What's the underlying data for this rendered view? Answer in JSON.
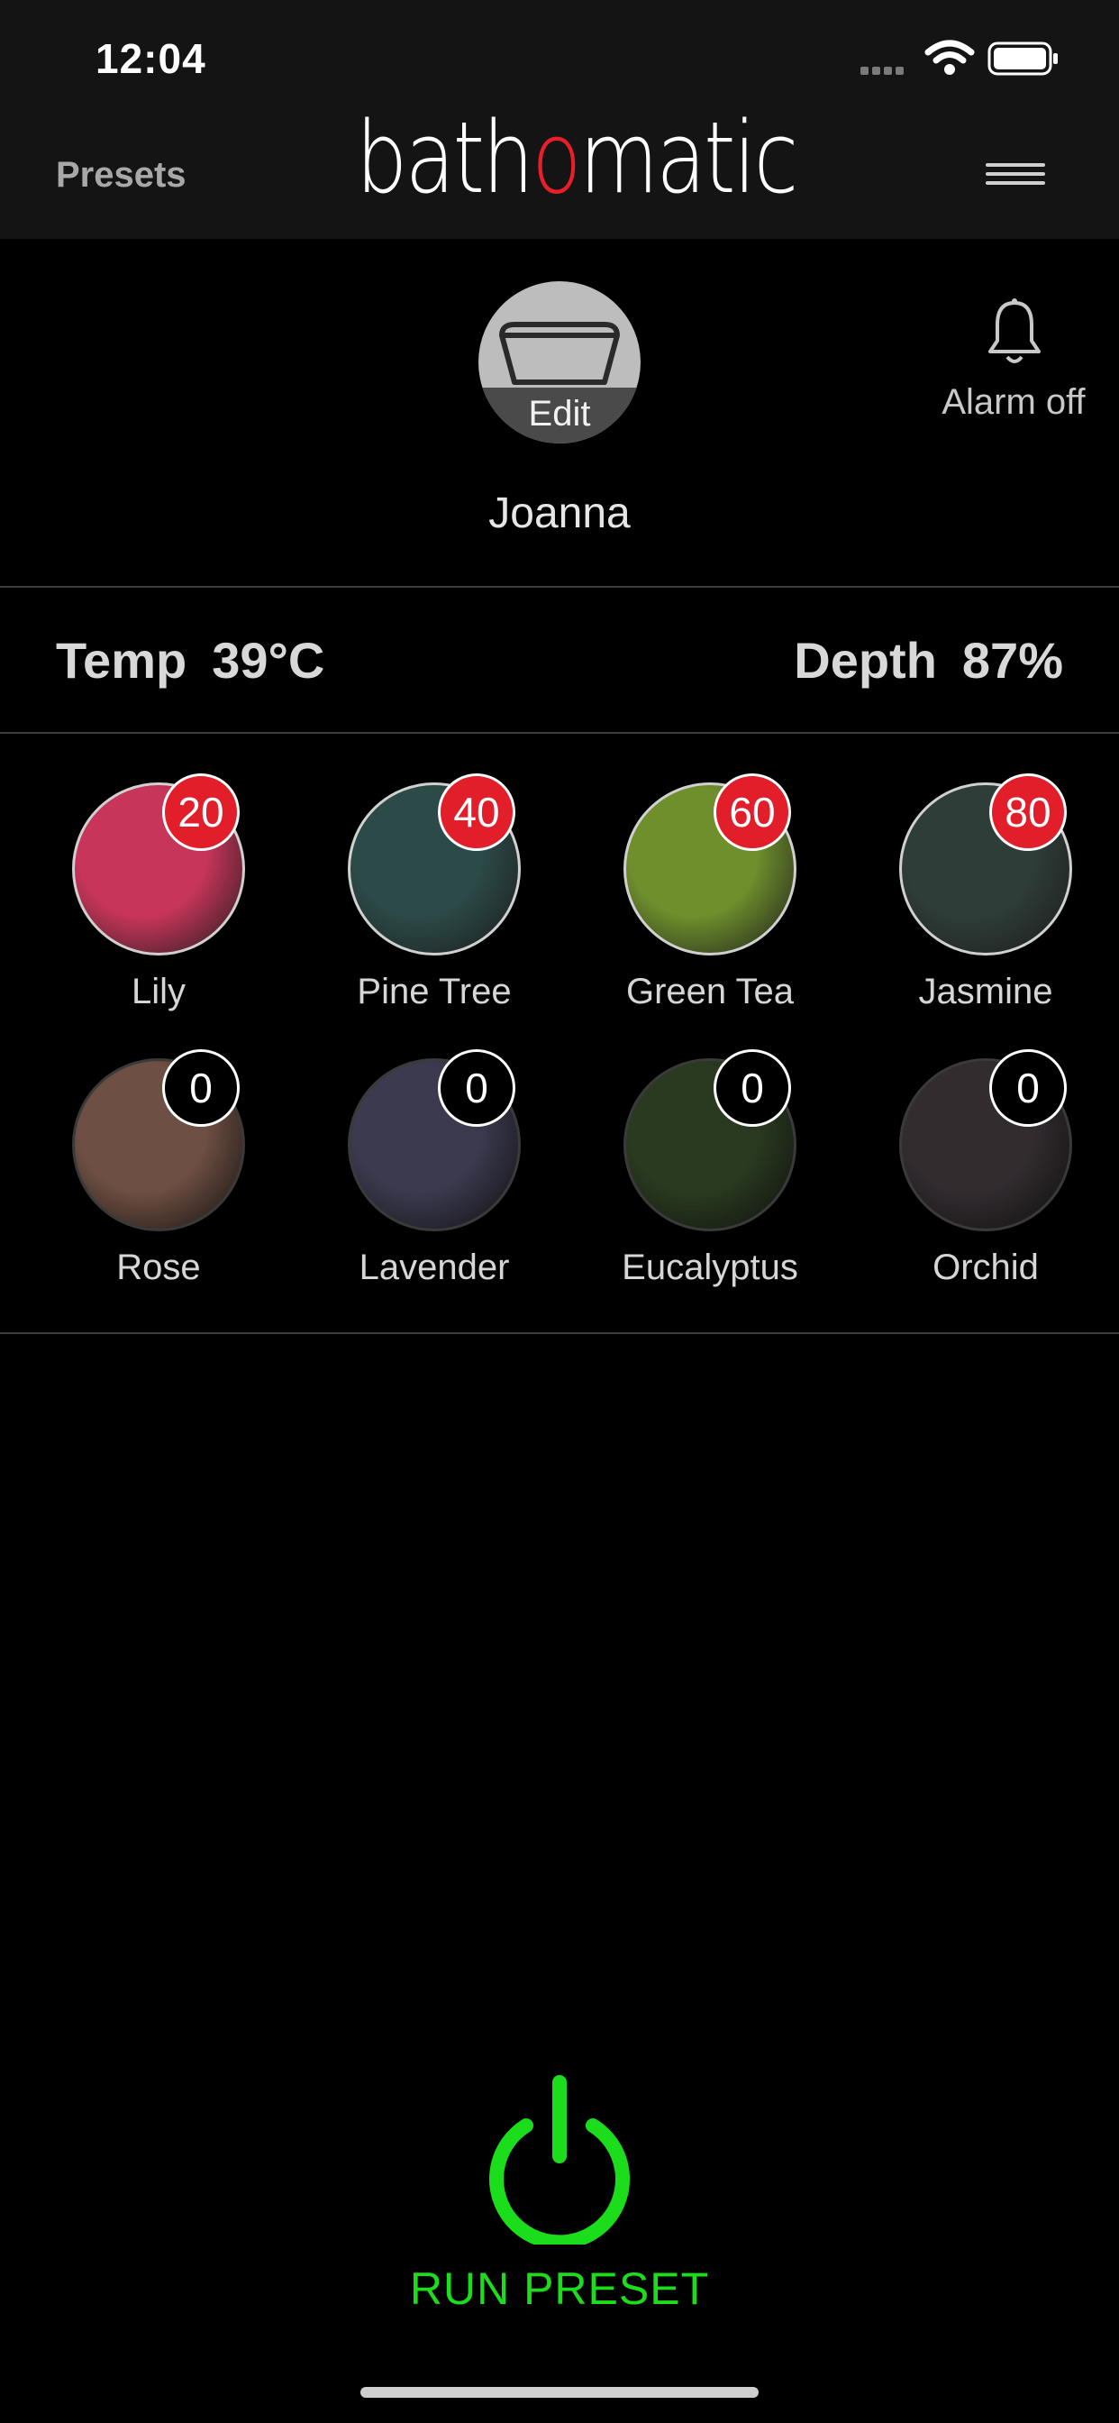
{
  "status_bar": {
    "time": "12:04",
    "icons": [
      "cellular-signal-icon",
      "wifi-icon",
      "battery-icon"
    ]
  },
  "header": {
    "presets_label": "Presets",
    "logo_text": {
      "before": "bath",
      "accent": "o",
      "after": "matic"
    },
    "menu_icon": "hamburger-menu-icon"
  },
  "profile": {
    "avatar_icon": "bathtub-icon",
    "edit_label": "Edit",
    "name": "Joanna",
    "alarm_label": "Alarm off",
    "alarm_icon": "bell-icon"
  },
  "settings": {
    "temp_label": "Temp",
    "temp_value": "39°C",
    "depth_label": "Depth",
    "depth_value": "87%"
  },
  "scents": [
    {
      "name": "Lily",
      "value": "20",
      "active": true,
      "color": "#c8355a"
    },
    {
      "name": "Pine Tree",
      "value": "40",
      "active": true,
      "color": "#2c4a48"
    },
    {
      "name": "Green Tea",
      "value": "60",
      "active": true,
      "color": "#6f8f2c"
    },
    {
      "name": "Jasmine",
      "value": "80",
      "active": true,
      "color": "#2f3d38"
    },
    {
      "name": "Rose",
      "value": "0",
      "active": false,
      "color": "#c9907a"
    },
    {
      "name": "Lavender",
      "value": "0",
      "active": false,
      "color": "#6d6a8f"
    },
    {
      "name": "Eucalyptus",
      "value": "0",
      "active": false,
      "color": "#4d6b3c"
    },
    {
      "name": "Orchid",
      "value": "0",
      "active": false,
      "color": "#5c5157"
    }
  ],
  "run": {
    "label": "RUN PRESET",
    "color": "#1bdd1b",
    "icon": "power-icon"
  },
  "colors": {
    "accent_red": "#e31e2b",
    "active_green": "#1bdd1b",
    "background": "#000000",
    "header": "#141414"
  }
}
